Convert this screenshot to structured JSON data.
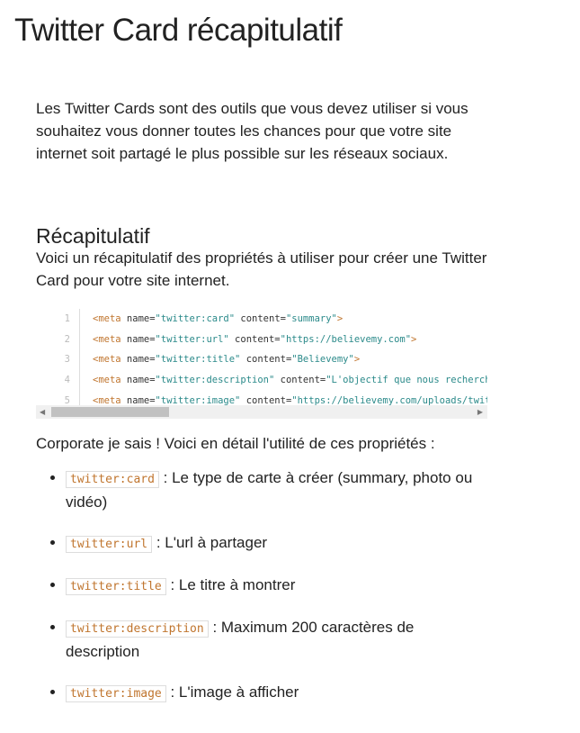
{
  "title": "Twitter Card récapitulatif",
  "intro": "Les Twitter Cards sont des outils que vous devez utiliser si vous souhaitez vous donner toutes les chances pour que votre site internet soit partagé le plus possible sur les réseaux sociaux.",
  "section_heading": "Récapitulatif",
  "section_text": "Voici un récapitulatif des propriétés à utiliser pour créer une Twitter Card pour votre site internet.",
  "code": [
    {
      "n": "1",
      "tag": "<meta",
      "attr1": " name=",
      "v1": "\"twitter:card\"",
      "attr2": " content=",
      "v2": "\"summary\"",
      "end": ">"
    },
    {
      "n": "2",
      "tag": "<meta",
      "attr1": " name=",
      "v1": "\"twitter:url\"",
      "attr2": " content=",
      "v2": "\"https://believemy.com\"",
      "end": ">"
    },
    {
      "n": "3",
      "tag": "<meta",
      "attr1": " name=",
      "v1": "\"twitter:title\"",
      "attr2": " content=",
      "v2": "\"Believemy\"",
      "end": ">"
    },
    {
      "n": "4",
      "tag": "<meta",
      "attr1": " name=",
      "v1": "\"twitter:description\"",
      "attr2": " content=",
      "v2": "\"L'objectif que nous recherchons\"",
      "end": ">"
    },
    {
      "n": "5",
      "tag": "<meta",
      "attr1": " name=",
      "v1": "\"twitter:image\"",
      "attr2": " content=",
      "v2": "\"https://believemy.com/uploads/twitter.png\"",
      "end": ">"
    }
  ],
  "detail_intro": "Corporate je sais ! Voici en détail l'utilité de ces propriétés :",
  "items": [
    {
      "code": "twitter:card",
      "text": " : Le type de carte à créer (summary, photo ou vidéo)"
    },
    {
      "code": "twitter:url",
      "text": " : L'url à partager"
    },
    {
      "code": "twitter:title",
      "text": " : Le titre à montrer"
    },
    {
      "code": "twitter:description",
      "text": " : Maximum 200 caractères de description"
    },
    {
      "code": "twitter:image",
      "text": " : L'image à afficher"
    }
  ]
}
